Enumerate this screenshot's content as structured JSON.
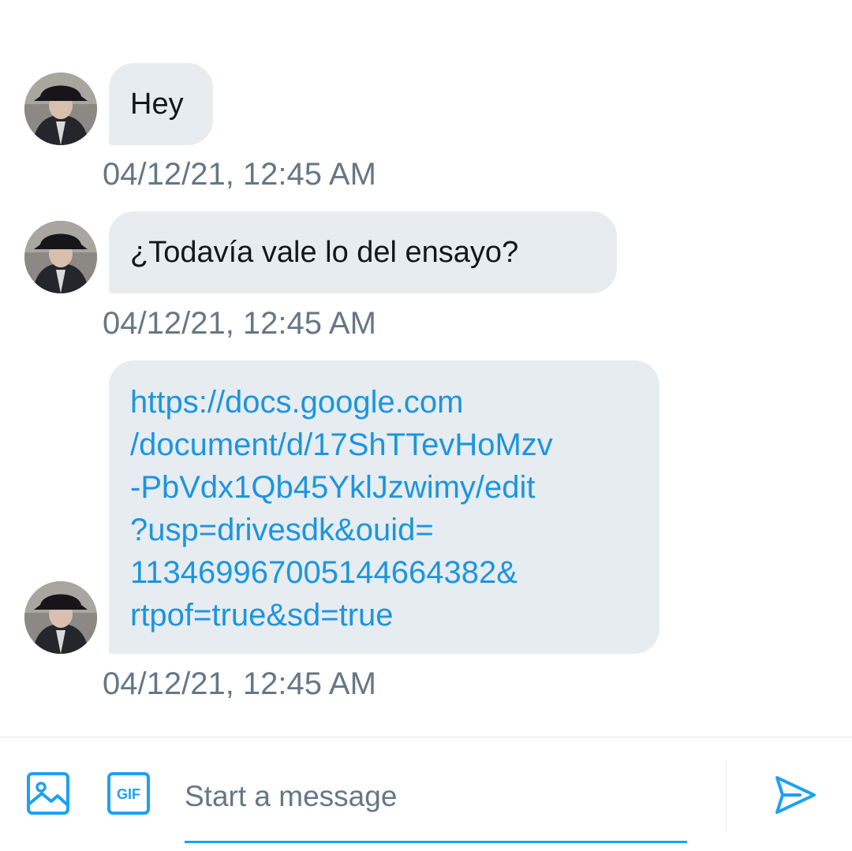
{
  "conversation": {
    "messages": [
      {
        "text": "Hey",
        "timestamp": "04/12/21, 12:45 AM"
      },
      {
        "text": "¿Todavía vale lo del ensayo?",
        "timestamp": "04/12/21, 12:45 AM"
      },
      {
        "link_lines": [
          "https://docs.google.com",
          "/document/d/17ShTTevHoMzv",
          "-PbVdx1Qb45YklJzwimy/edit",
          "?usp=drivesdk&ouid=",
          "113469967005144664382&",
          "rtpof=true&sd=true"
        ],
        "timestamp": "04/12/21, 12:45 AM"
      }
    ]
  },
  "composer": {
    "placeholder": "Start a message",
    "image_icon": "image-icon",
    "gif_icon": "gif-icon",
    "gif_label": "GIF",
    "send_icon": "send-icon"
  },
  "colors": {
    "accent": "#1da1f2",
    "link": "#1b95e0",
    "bubble": "#e6ecf0",
    "timestamp": "#657786"
  }
}
